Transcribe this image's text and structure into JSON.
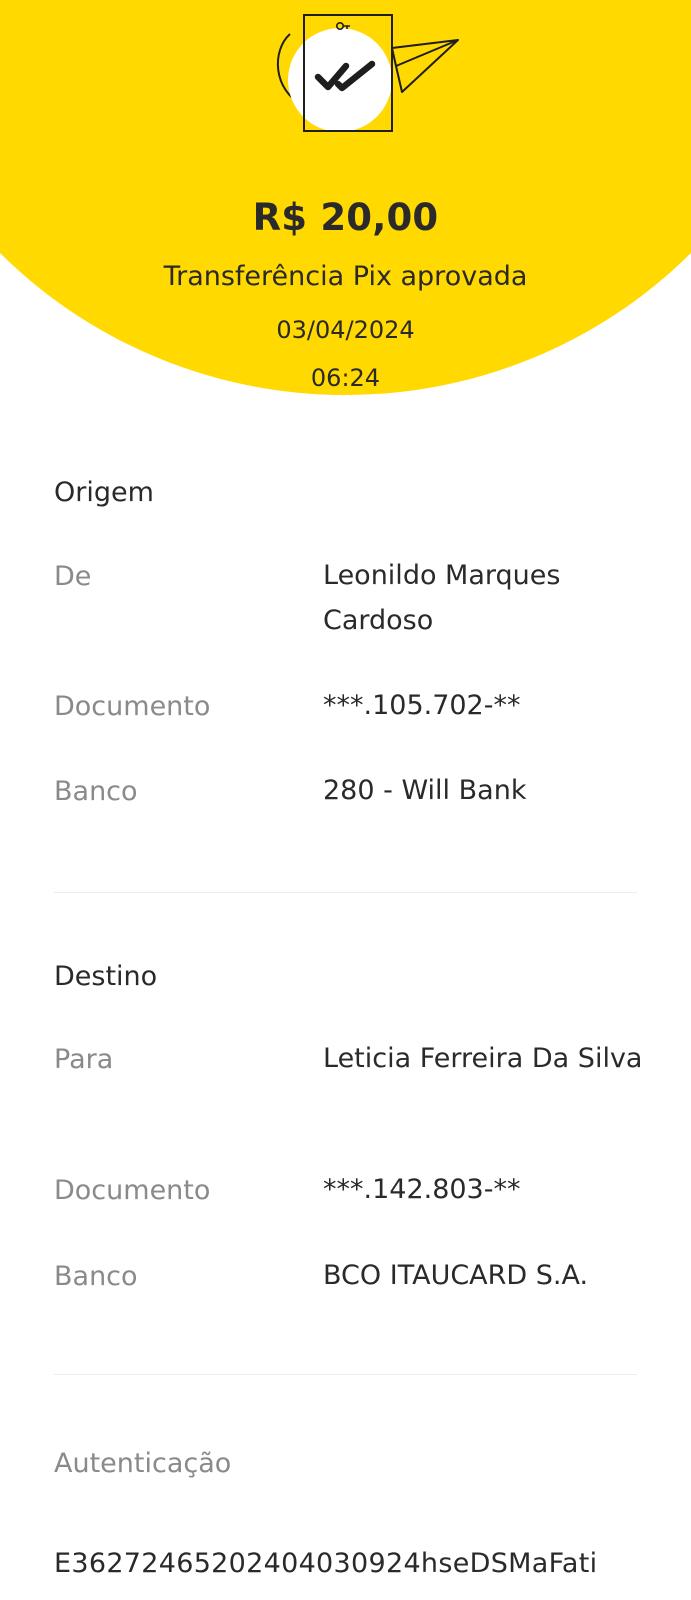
{
  "theme": {
    "accent": "#FFD900",
    "text": "#2A2A2A",
    "muted": "#8A8A8A"
  },
  "header": {
    "amount": "R$ 20,00",
    "status": "Transferência Pix aprovada",
    "date": "03/04/2024",
    "time": "06:24",
    "illustration_icon": "receipt-check-paper-plane-icon"
  },
  "origin": {
    "title": "Origem",
    "de_label": "De",
    "de_value": "Leonildo Marques Cardoso",
    "documento_label": "Documento",
    "documento_value": "***.105.702-**",
    "banco_label": "Banco",
    "banco_value": "280 - Will Bank"
  },
  "destination": {
    "title": "Destino",
    "para_label": "Para",
    "para_value": "Leticia Ferreira Da Silva",
    "documento_label": "Documento",
    "documento_value": "***.142.803-**",
    "banco_label": "Banco",
    "banco_value": "BCO ITAUCARD S.A."
  },
  "authentication": {
    "label": "Autenticação",
    "value": "E36272465202404030924hseDSMaFati"
  }
}
